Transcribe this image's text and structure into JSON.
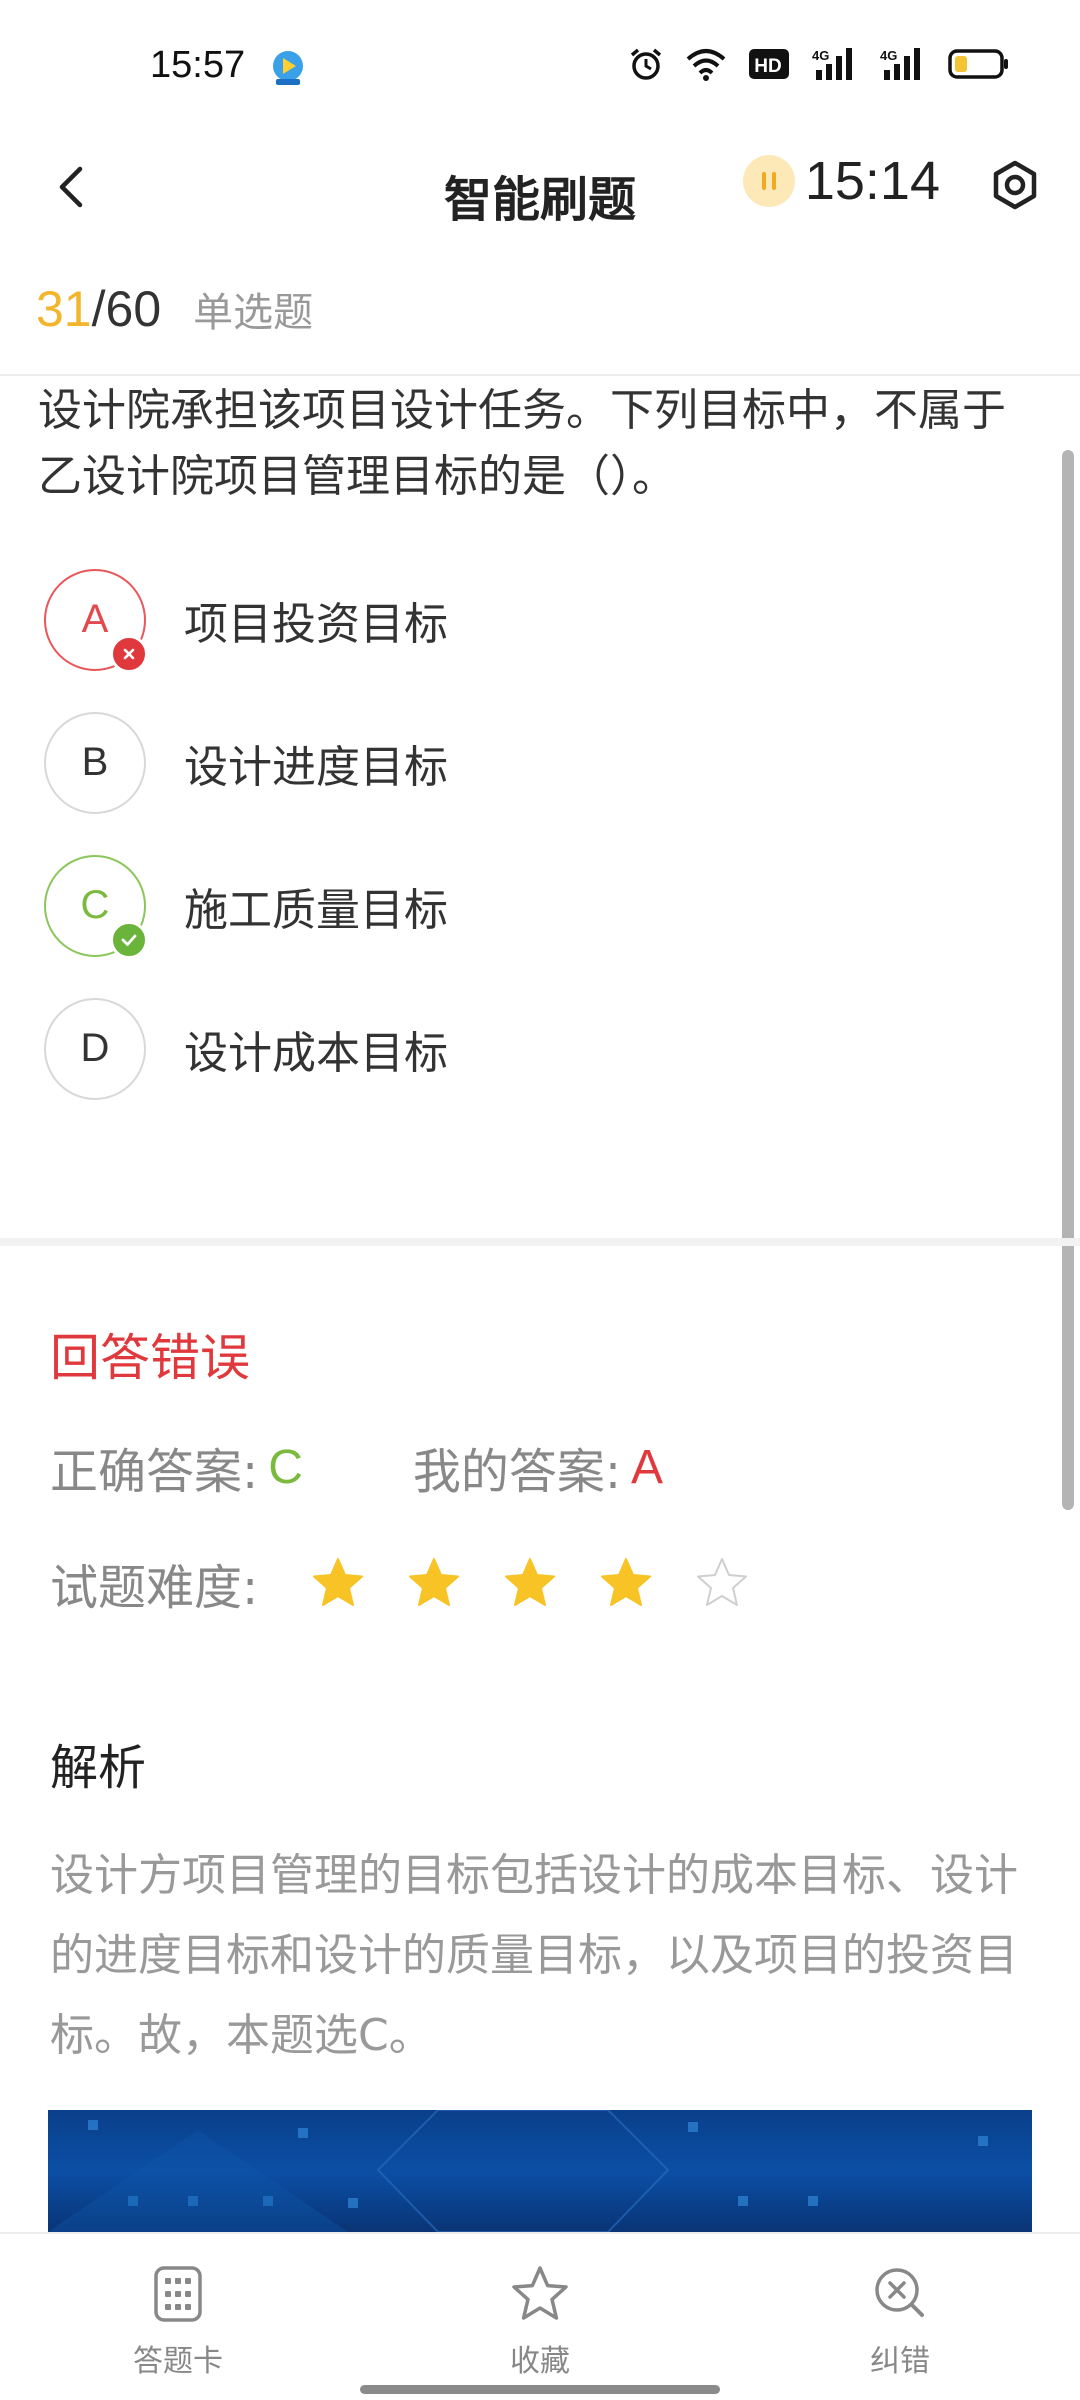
{
  "status_bar": {
    "time": "15:57",
    "icons": [
      "alarm-icon",
      "wifi-icon",
      "hd-icon",
      "signal-4g-icon",
      "signal-4g-icon",
      "battery-icon"
    ],
    "hd_text": "HD",
    "network_label": "4G"
  },
  "header": {
    "title": "智能刷题",
    "timer": "15:14"
  },
  "progress": {
    "current": "31",
    "total": "/60",
    "question_type": "单选题"
  },
  "question": {
    "text": "设计院承担该项目设计任务。下列目标中，不属于乙设计院项目管理目标的是（）。"
  },
  "options": [
    {
      "letter": "A",
      "label": "项目投资目标",
      "state": "wrong"
    },
    {
      "letter": "B",
      "label": "设计进度目标",
      "state": "normal"
    },
    {
      "letter": "C",
      "label": "施工质量目标",
      "state": "right"
    },
    {
      "letter": "D",
      "label": "设计成本目标",
      "state": "normal"
    }
  ],
  "result": {
    "title": "回答错误",
    "correct_label": "正确答案:",
    "correct_value": "C",
    "mine_label": "我的答案:",
    "mine_value": "A",
    "difficulty_label": "试题难度:",
    "difficulty_rating": 4,
    "difficulty_max": 5
  },
  "analysis": {
    "title": "解析",
    "text": "设计方项目管理的目标包括设计的成本目标、设计的进度目标和设计的质量目标，以及项目的投资目标。故，本题选C。"
  },
  "bottom_nav": {
    "items": [
      {
        "label": "答题卡",
        "icon": "answer-sheet-icon"
      },
      {
        "label": "收藏",
        "icon": "star-icon"
      },
      {
        "label": "纠错",
        "icon": "error-report-icon"
      }
    ]
  },
  "colors": {
    "accent_yellow": "#f3b52b",
    "wrong_red": "#e0393d",
    "right_green": "#7cba3f",
    "star_gold": "#f7c325"
  }
}
